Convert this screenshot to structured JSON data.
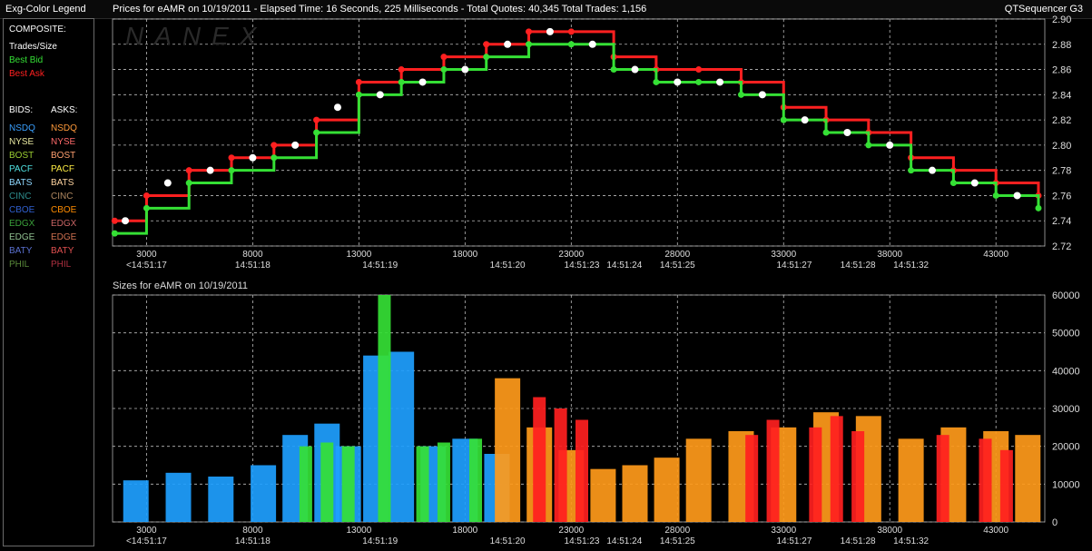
{
  "header": {
    "left_title": "Exg-Color Legend",
    "main_title": "Prices for  eAMR  on  10/19/2011  -  Elapsed Time: 16 Seconds, 225 Milliseconds  -  Total Quotes: 40,345  Total Trades: 1,156",
    "right_title": "QTSequencer G3"
  },
  "watermark": "NANEX",
  "legend": {
    "composite_label": "COMPOSITE:",
    "composite_items": [
      {
        "label": "Trades/Size",
        "color": "#ffffff"
      },
      {
        "label": "Best Bid",
        "color": "#35e035"
      },
      {
        "label": "Best Ask",
        "color": "#ff2020"
      }
    ],
    "bids_label": "BIDS:",
    "asks_label": "ASKS:",
    "exchanges": [
      {
        "bid": "NSDQ",
        "ask": "NSDQ",
        "bid_color": "#3aa0ff",
        "ask_color": "#ff9a3a"
      },
      {
        "bid": "NYSE",
        "ask": "NYSE",
        "bid_color": "#e8e8a0",
        "ask_color": "#ff6a6a"
      },
      {
        "bid": "BOST",
        "ask": "BOST",
        "bid_color": "#9acd32",
        "ask_color": "#ffa070"
      },
      {
        "bid": "PACF",
        "ask": "PACF",
        "bid_color": "#4fe0e0",
        "ask_color": "#ffee44"
      },
      {
        "bid": "BATS",
        "ask": "BATS",
        "bid_color": "#8fd8ff",
        "ask_color": "#ffd4a0"
      },
      {
        "bid": "CINC",
        "ask": "CINC",
        "bid_color": "#2f8f8f",
        "ask_color": "#b08860"
      },
      {
        "bid": "CBOE",
        "ask": "CBOE",
        "bid_color": "#3060d0",
        "ask_color": "#ff8c00"
      },
      {
        "bid": "EDGX",
        "ask": "EDGX",
        "bid_color": "#3aa03a",
        "ask_color": "#c86464"
      },
      {
        "bid": "EDGE",
        "ask": "EDGE",
        "bid_color": "#90c090",
        "ask_color": "#d07050"
      },
      {
        "bid": "BATY",
        "ask": "BATY",
        "bid_color": "#5a70d0",
        "ask_color": "#e05050"
      },
      {
        "bid": "PHIL",
        "ask": "PHIL",
        "bid_color": "#5a8a3a",
        "ask_color": "#b03040"
      }
    ]
  },
  "chart_data": [
    {
      "type": "line",
      "title": "Prices for  eAMR  on  10/19/2011",
      "xlabel": "",
      "ylabel": "",
      "xlim": [
        1400,
        45300
      ],
      "ylim": [
        2.72,
        2.9
      ],
      "x_ticks": [
        3000,
        8000,
        13000,
        18000,
        23000,
        28000,
        33000,
        38000,
        43000
      ],
      "y_ticks": [
        "2.72",
        "2.74",
        "2.76",
        "2.78",
        "2.80",
        "2.82",
        "2.84",
        "2.86",
        "2.88",
        "2.90"
      ],
      "time_labels": [
        {
          "x": 3000,
          "label": "<14:51:17"
        },
        {
          "x": 8000,
          "label": "14:51:18"
        },
        {
          "x": 14000,
          "label": "14:51:19"
        },
        {
          "x": 20000,
          "label": "14:51:20"
        },
        {
          "x": 23500,
          "label": "14:51:23"
        },
        {
          "x": 25500,
          "label": "14:51:24"
        },
        {
          "x": 28000,
          "label": "14:51:25"
        },
        {
          "x": 33500,
          "label": "14:51:27"
        },
        {
          "x": 36500,
          "label": "14:51:28"
        },
        {
          "x": 39000,
          "label": "14:51:32"
        }
      ],
      "grid": true,
      "series": [
        {
          "name": "Best Ask",
          "color": "#ff2020",
          "x": [
            1500,
            3000,
            5000,
            7000,
            9000,
            11000,
            13000,
            15000,
            17000,
            19000,
            21000,
            23000,
            25000,
            27000,
            29000,
            31000,
            33000,
            35000,
            37000,
            39000,
            41000,
            43000,
            45000
          ],
          "y": [
            2.74,
            2.76,
            2.78,
            2.79,
            2.8,
            2.82,
            2.85,
            2.86,
            2.87,
            2.88,
            2.89,
            2.89,
            2.87,
            2.86,
            2.86,
            2.85,
            2.83,
            2.82,
            2.81,
            2.79,
            2.78,
            2.77,
            2.76
          ]
        },
        {
          "name": "Best Bid",
          "color": "#35e035",
          "x": [
            1500,
            3000,
            5000,
            7000,
            9000,
            11000,
            13000,
            15000,
            17000,
            19000,
            21000,
            23000,
            25000,
            27000,
            29000,
            31000,
            33000,
            35000,
            37000,
            39000,
            41000,
            43000,
            45000
          ],
          "y": [
            2.73,
            2.75,
            2.77,
            2.78,
            2.79,
            2.81,
            2.84,
            2.85,
            2.86,
            2.87,
            2.88,
            2.88,
            2.86,
            2.85,
            2.85,
            2.84,
            2.82,
            2.81,
            2.8,
            2.78,
            2.77,
            2.76,
            2.75
          ]
        },
        {
          "name": "Trades/Size",
          "color": "#ffffff",
          "x": [
            2000,
            4000,
            6000,
            8000,
            10000,
            12000,
            14000,
            16000,
            18000,
            20000,
            22000,
            24000,
            26000,
            28000,
            30000,
            32000,
            34000,
            36000,
            38000,
            40000,
            42000,
            44000
          ],
          "y": [
            2.74,
            2.77,
            2.78,
            2.79,
            2.8,
            2.83,
            2.84,
            2.85,
            2.86,
            2.88,
            2.89,
            2.88,
            2.86,
            2.85,
            2.85,
            2.84,
            2.82,
            2.81,
            2.8,
            2.78,
            2.77,
            2.76
          ]
        }
      ]
    },
    {
      "type": "bar",
      "title": "Sizes for  eAMR  on  10/19/2011",
      "xlabel": "",
      "ylabel": "",
      "xlim": [
        1400,
        45300
      ],
      "ylim": [
        0,
        60000
      ],
      "x_ticks": [
        3000,
        8000,
        13000,
        18000,
        23000,
        28000,
        33000,
        38000,
        43000
      ],
      "y_ticks": [
        "0",
        "10000",
        "20000",
        "30000",
        "40000",
        "50000",
        "60000"
      ],
      "time_labels": [
        {
          "x": 3000,
          "label": "<14:51:17"
        },
        {
          "x": 8000,
          "label": "14:51:18"
        },
        {
          "x": 14000,
          "label": "14:51:19"
        },
        {
          "x": 20000,
          "label": "14:51:20"
        },
        {
          "x": 23500,
          "label": "14:51:23"
        },
        {
          "x": 25500,
          "label": "14:51:24"
        },
        {
          "x": 28000,
          "label": "14:51:25"
        },
        {
          "x": 33500,
          "label": "14:51:27"
        },
        {
          "x": 36500,
          "label": "14:51:28"
        },
        {
          "x": 39000,
          "label": "14:51:32"
        }
      ],
      "grid": true,
      "series": [
        {
          "name": "NSDQ",
          "color": "#1e9fff",
          "x": [
            2500,
            4500,
            6500,
            8500,
            10000,
            11500,
            12500,
            13800,
            15000,
            16500,
            18000,
            19500
          ],
          "y": [
            11000,
            13000,
            12000,
            15000,
            23000,
            26000,
            20000,
            44000,
            45000,
            20000,
            22000,
            18000
          ]
        },
        {
          "name": "CBOE",
          "color": "#ff9a1a",
          "x": [
            20000,
            21500,
            23000,
            24500,
            26000,
            27500,
            29000,
            31000,
            33000,
            35000,
            37000,
            39000,
            41000,
            43000,
            44500
          ],
          "y": [
            38000,
            25000,
            19000,
            14000,
            15000,
            17000,
            22000,
            24000,
            25000,
            29000,
            28000,
            22000,
            25000,
            24000,
            23000
          ]
        },
        {
          "name": "Best Bid",
          "color": "#35e035",
          "x": [
            10500,
            11500,
            12500,
            14200,
            16000,
            17000,
            18500
          ],
          "y": [
            20000,
            21000,
            20000,
            60000,
            20000,
            21000,
            22000
          ]
        },
        {
          "name": "Best Ask",
          "color": "#ff2020",
          "x": [
            21500,
            22500,
            23500,
            31500,
            32500,
            34500,
            35500,
            36500,
            40500,
            42500,
            43500
          ],
          "y": [
            33000,
            30000,
            27000,
            23000,
            27000,
            25000,
            28000,
            24000,
            23000,
            22000,
            19000
          ]
        }
      ]
    }
  ]
}
